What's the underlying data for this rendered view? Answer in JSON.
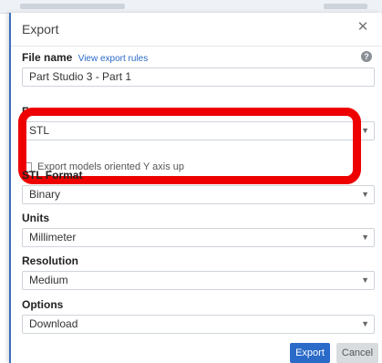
{
  "dialog": {
    "title": "Export",
    "close_icon": "close-icon"
  },
  "file_name": {
    "label": "File name",
    "link": "View export rules",
    "value": "Part Studio 3 - Part 1",
    "help_icon": "help-icon"
  },
  "format": {
    "label": "Format",
    "value": "STL"
  },
  "checkbox": {
    "label": "Export models oriented Y axis up",
    "checked": false
  },
  "stl_format": {
    "label": "STL Format",
    "value": "Binary"
  },
  "units": {
    "label": "Units",
    "value": "Millimeter"
  },
  "resolution": {
    "label": "Resolution",
    "value": "Medium"
  },
  "options": {
    "label": "Options",
    "value": "Download"
  },
  "buttons": {
    "export": "Export",
    "cancel": "Cancel"
  },
  "colors": {
    "accent": "#2a6ac8",
    "highlight": "#ee0000"
  }
}
